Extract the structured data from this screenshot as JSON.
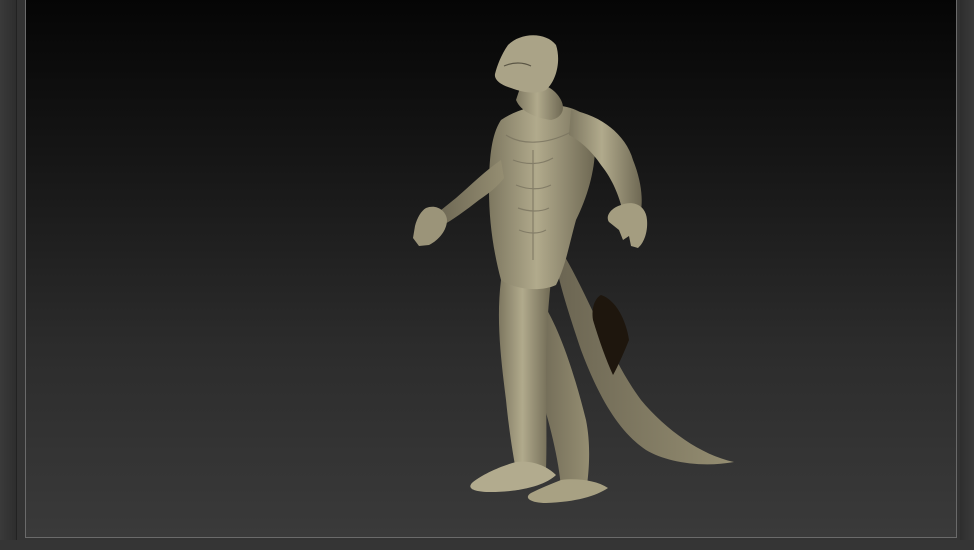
{
  "app": {
    "name": "",
    "document": {
      "model": "lizard-creature",
      "material_color": "#a59e80",
      "background_top": "#050505",
      "background_bottom": "#3a3a3a"
    }
  }
}
